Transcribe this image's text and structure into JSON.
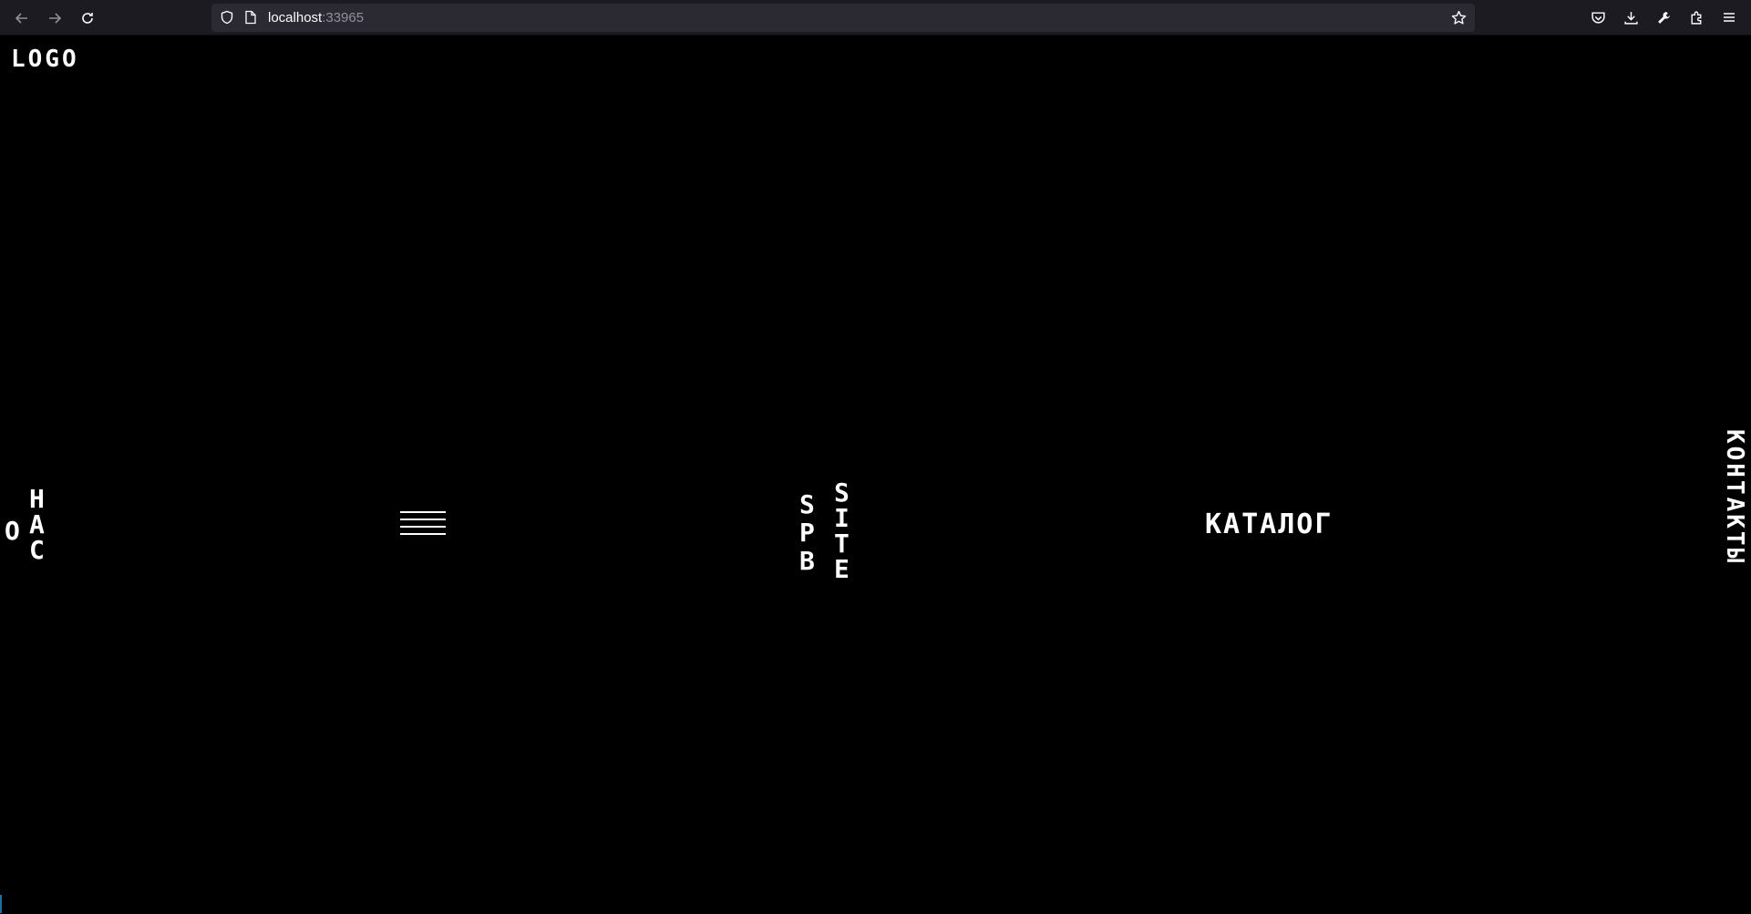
{
  "browser": {
    "url_host": "localhost",
    "url_port": ":33965",
    "back_icon": "back-arrow-icon",
    "forward_icon": "forward-arrow-icon",
    "reload_icon": "reload-icon"
  },
  "page": {
    "logo": "LOGO",
    "about_first": "О",
    "about_rest": [
      "Н",
      "А",
      "С"
    ],
    "brand_col_1": [
      "S",
      "P",
      "B"
    ],
    "brand_col_2": [
      "S",
      "I",
      "T",
      "E"
    ],
    "catalog": "КАТАЛОГ",
    "contacts": "КОНТАКТЫ",
    "menu_icon": "hamburger-menu-icon"
  },
  "colors": {
    "background": "#000000",
    "text": "#ffffff",
    "chrome": "#1c1b22",
    "urlbar": "#2b2a33"
  }
}
